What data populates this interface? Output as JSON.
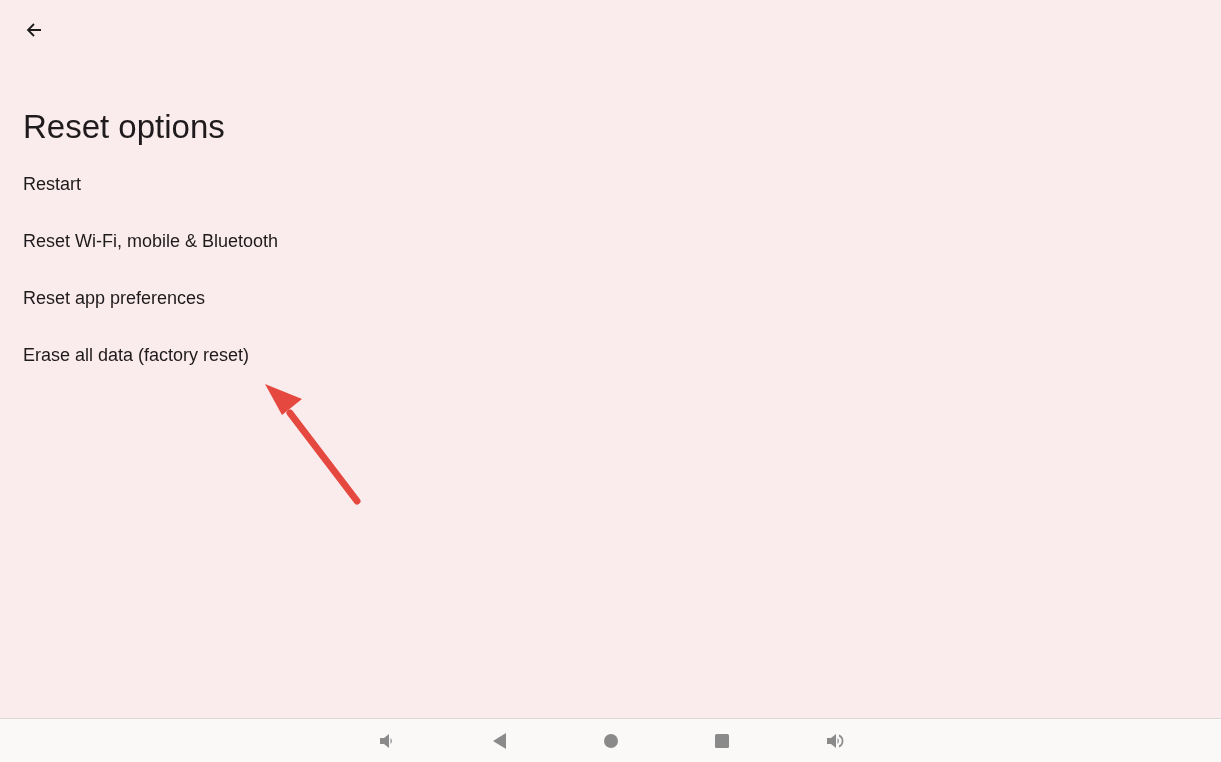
{
  "title": "Reset options",
  "items": [
    {
      "label": "Restart"
    },
    {
      "label": "Reset Wi-Fi, mobile & Bluetooth"
    },
    {
      "label": "Reset app preferences"
    },
    {
      "label": "Erase all data (factory reset)"
    }
  ],
  "nav_bar": [
    {
      "kind": "volume_down"
    },
    {
      "kind": "back"
    },
    {
      "kind": "home"
    },
    {
      "kind": "recents"
    },
    {
      "kind": "volume_up"
    }
  ]
}
